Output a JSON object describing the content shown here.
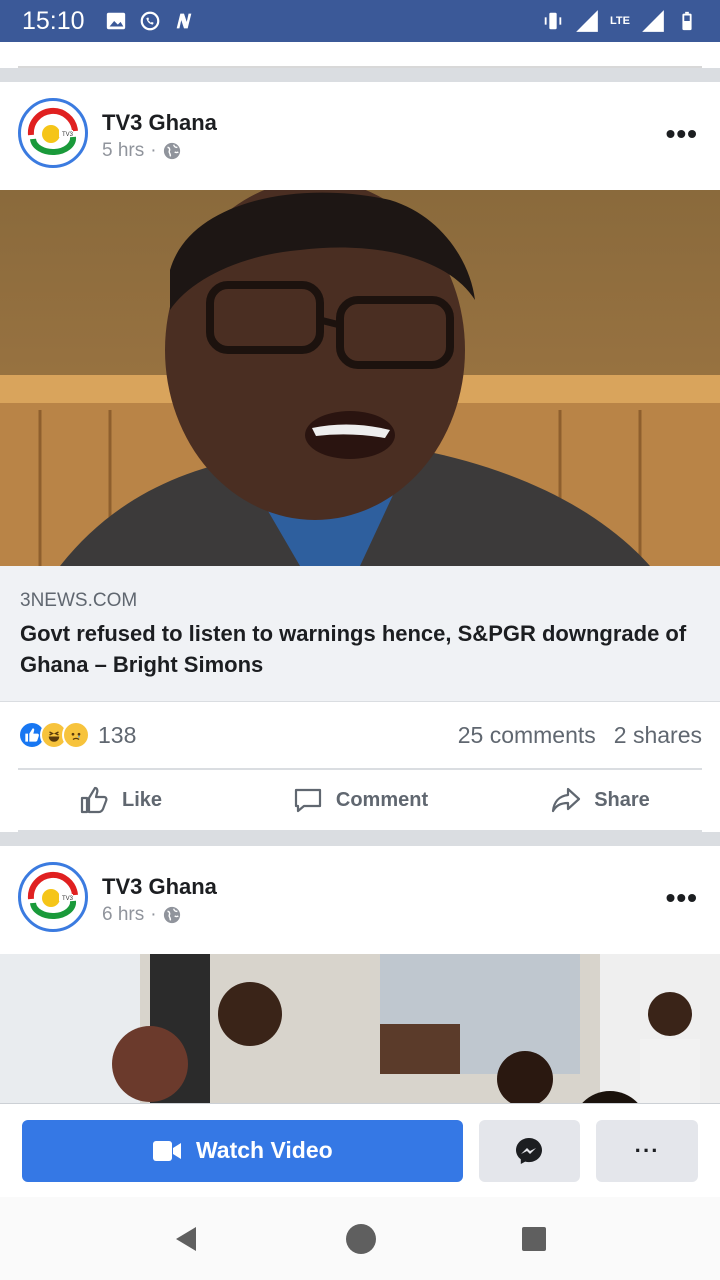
{
  "status_bar": {
    "time": "15:10",
    "left_icons": [
      "image-icon",
      "whatsapp-icon",
      "n-app-icon"
    ],
    "right_icons": [
      "vibrate-icon",
      "signal-icon",
      "lte-icon",
      "signal-icon",
      "battery-icon"
    ],
    "network": "LTE"
  },
  "posts": [
    {
      "page_name": "TV3 Ghana",
      "time": "5 hrs",
      "separator": "·",
      "privacy_icon": "globe-icon",
      "link_domain": "3NEWS.COM",
      "link_title": "Govt refused to listen to warnings hence, S&PGR downgrade of Ghana – Bright Simons",
      "reaction_icons": [
        "like-reaction-icon",
        "haha-reaction-icon",
        "sad-reaction-icon"
      ],
      "reaction_count": "138",
      "comments": "25 comments",
      "shares": "2 shares",
      "actions": {
        "like": "Like",
        "comment": "Comment",
        "share": "Share"
      }
    },
    {
      "page_name": "TV3 Ghana",
      "time": "6 hrs",
      "separator": "·",
      "privacy_icon": "globe-icon"
    }
  ],
  "bottom_bar": {
    "watch_label": "Watch Video",
    "messenger_icon": "messenger-icon",
    "more_label": "···"
  },
  "colors": {
    "brand_blue": "#3b5998",
    "button_blue": "#3578e5",
    "text_primary": "#1c1e21",
    "text_secondary": "#606770"
  }
}
